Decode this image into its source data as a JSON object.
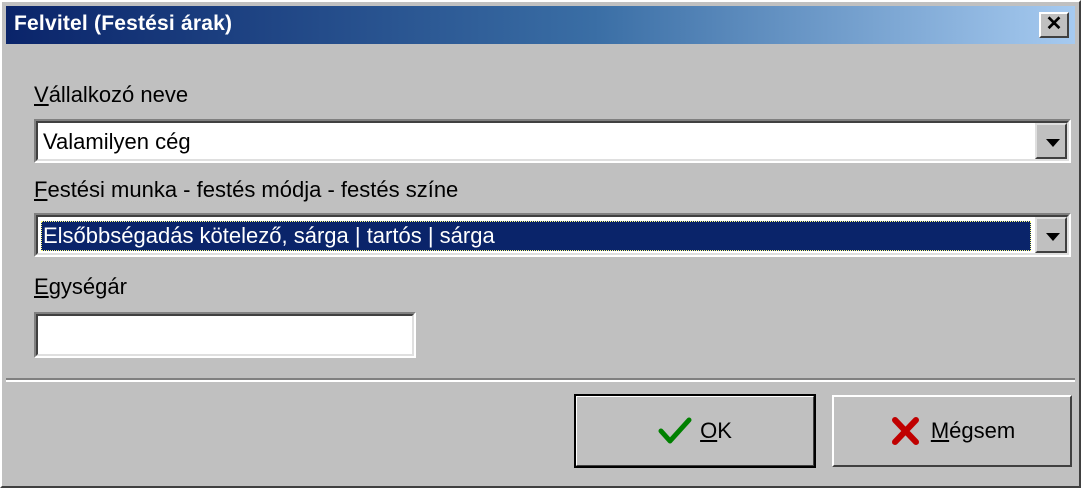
{
  "window": {
    "title": "Felvitel (Festési árak)",
    "close_glyph": "✕"
  },
  "fields": {
    "contractor": {
      "label_accel": "V",
      "label_rest": "állalkozó neve",
      "value": "Valamilyen cég"
    },
    "work": {
      "label_accel": "F",
      "label_rest": "estési munka - festés módja - festés színe",
      "value": "Elsőbbségadás kötelező, sárga | tartós | sárga"
    },
    "unit_price": {
      "label_accel": "E",
      "label_rest": "gységár",
      "value": ""
    }
  },
  "buttons": {
    "ok": {
      "accel": "O",
      "rest": "K",
      "icon": "checkmark-icon",
      "icon_color": "#008000"
    },
    "cancel": {
      "accel": "M",
      "rest": "égsem",
      "icon": "x-mark-icon",
      "icon_color": "#c00000"
    }
  },
  "colors": {
    "titlebar_start": "#0a246a",
    "titlebar_end": "#a6caf0",
    "selection": "#0a246a",
    "face": "#c0c0c0"
  }
}
